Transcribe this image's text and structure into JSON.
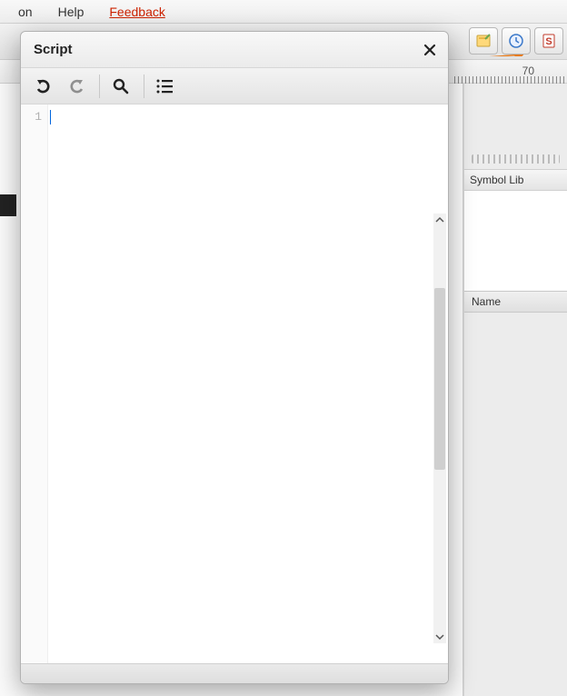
{
  "menubar": {
    "item_partial": "on",
    "help": "Help",
    "feedback": "Feedback"
  },
  "ruler": {
    "tick70": "70"
  },
  "right_panel": {
    "symbol_lib": "Symbol Lib",
    "name_col": "Name"
  },
  "dialog": {
    "title": "Script",
    "line1": "1",
    "code": ""
  },
  "toolbar_icons": {
    "undo": "undo-icon",
    "redo": "redo-icon",
    "find": "search-icon",
    "menu": "list-menu-icon"
  },
  "main_icons": {
    "form": "form-icon",
    "clock": "clock-icon",
    "script": "script-s-icon"
  }
}
